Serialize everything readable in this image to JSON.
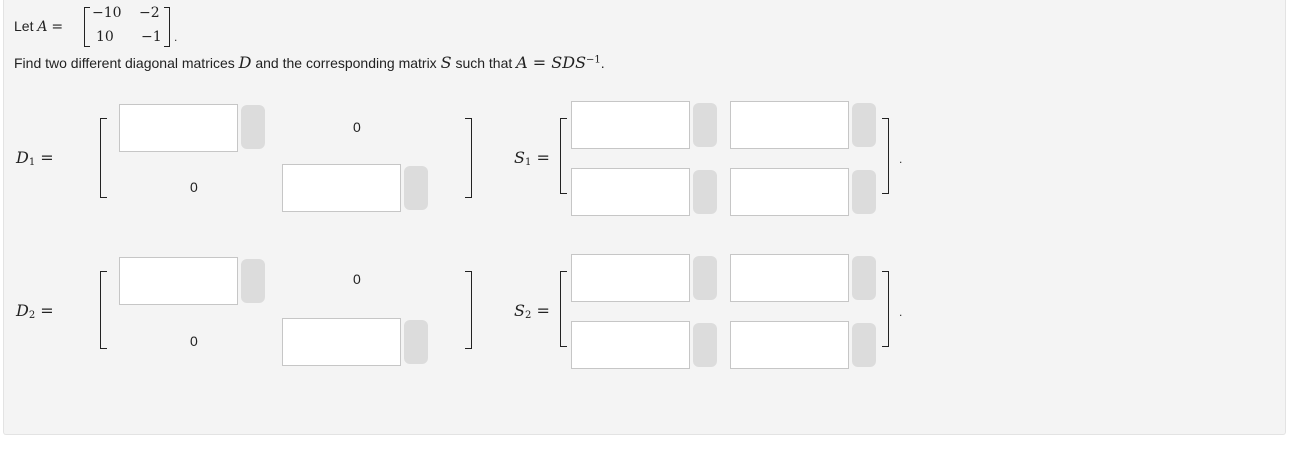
{
  "problem": {
    "let_text": "Let",
    "A_symbol": "A",
    "equals": "=",
    "matrix_A": [
      [
        "−10",
        "−2"
      ],
      [
        "10",
        "−1"
      ]
    ],
    "instruction_pre": "Find two different diagonal matrices",
    "instruction_D": "D",
    "instruction_mid": "and the corresponding matrix",
    "instruction_S": "S",
    "instruction_post": "such that",
    "formula": "A = SDS",
    "formula_exp": "−1",
    "period": "."
  },
  "answers": {
    "D1": {
      "label": "D",
      "sub": "1",
      "eq": "=",
      "off_diag_top": "0",
      "off_diag_bottom": "0",
      "values": [
        "",
        ""
      ]
    },
    "S1": {
      "label": "S",
      "sub": "1",
      "eq": "=",
      "values": [
        "",
        "",
        "",
        ""
      ]
    },
    "D2": {
      "label": "D",
      "sub": "2",
      "eq": "=",
      "off_diag_top": "0",
      "off_diag_bottom": "0",
      "values": [
        "",
        ""
      ]
    },
    "S2": {
      "label": "S",
      "sub": "2",
      "eq": "=",
      "values": [
        "",
        "",
        "",
        ""
      ]
    },
    "trailing_dot": "."
  }
}
